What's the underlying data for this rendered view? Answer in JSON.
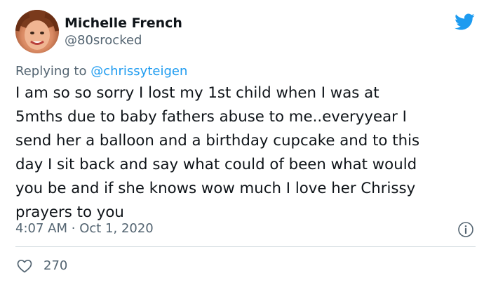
{
  "user": {
    "name": "Michelle French",
    "handle": "@80srocked"
  },
  "reply": {
    "prefix": "Replying to",
    "to": "@chrissyteigen"
  },
  "tweet": {
    "lines": [
      "I am so so sorry I lost my 1st child when I was at",
      "5mths due to baby fathers abuse to me..everyyear I",
      "send her a balloon and a birthday cupcake and to this",
      "day I sit back and say what could of been what would",
      "you be and if she knows wow much I love her Chrissy",
      "prayers to you"
    ]
  },
  "meta": {
    "time": "4:07 AM",
    "separator": "·",
    "date": "Oct 1, 2020"
  },
  "stats": {
    "likes": "270"
  },
  "colors": {
    "brand": "#1d9bf0",
    "text": "#0f1419",
    "secondary": "#536471",
    "divider": "#cfd9de"
  },
  "icons": {
    "brand": "twitter-bird-icon",
    "info": "info-icon",
    "like": "heart-icon"
  }
}
